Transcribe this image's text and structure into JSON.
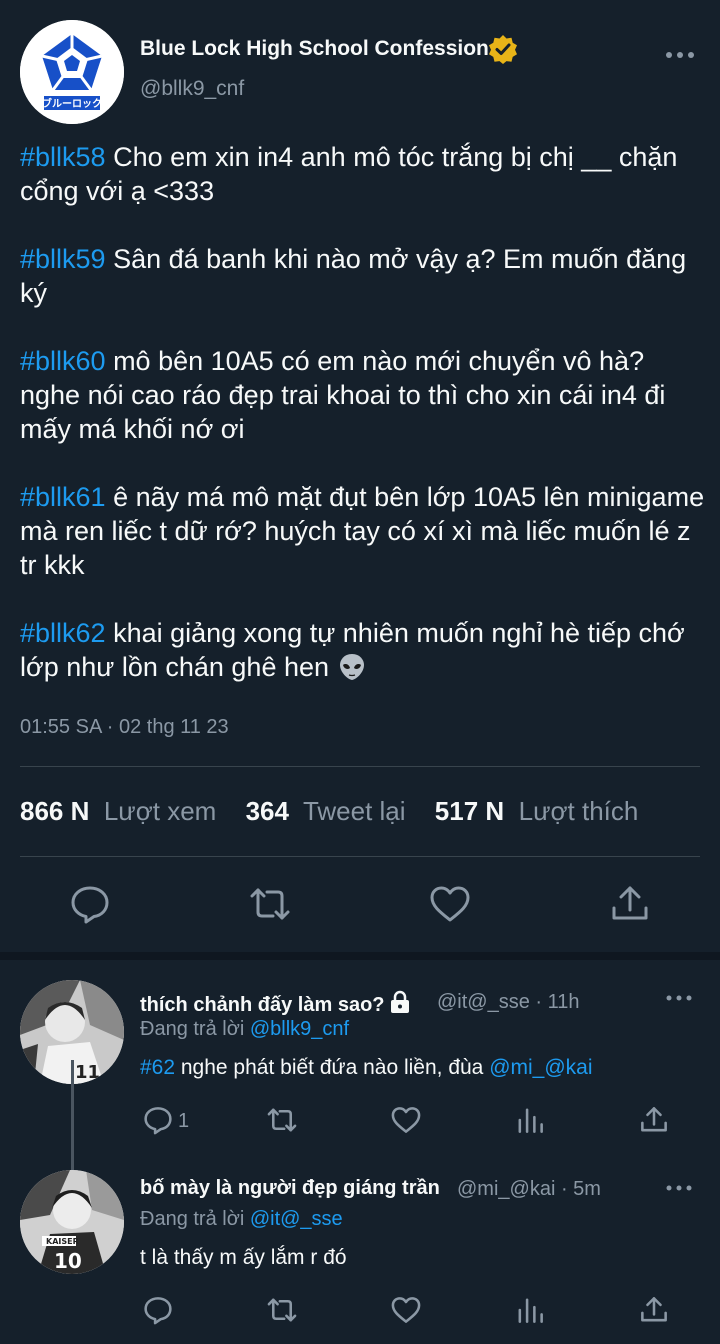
{
  "tweet": {
    "author": {
      "name": "Blue Lock High School Confession",
      "handle": "@bllk9_cnf",
      "logo_text": "ブルーロック"
    },
    "posts": [
      {
        "tag": "#bllk58",
        "text": " Cho em xin in4 anh mô tóc trắng bị chị __ chặn cổng với ạ <333"
      },
      {
        "tag": "#bllk59",
        "text": " Sân đá banh khi nào mở vậy ạ? Em muốn đăng ký"
      },
      {
        "tag": "#bllk60",
        "text": " mô bên 10A5 có em nào mới chuyển vô hà? nghe nói cao ráo đẹp trai khoai to thì cho xin cái in4 đi mấy má khối nớ ơi"
      },
      {
        "tag": "#bllk61",
        "text": " ê nãy má mô mặt đụt bên lớp 10A5 lên minigame mà ren liếc t dữ rớ? huých tay có xí xì mà liếc muốn lé z tr kkk"
      },
      {
        "tag": "#bllk62",
        "text": " khai giảng xong tự nhiên muốn nghỉ hè tiếp chớ lớp như lồn chán ghê hen "
      }
    ],
    "timestamp": "01:55 SA · 02 thg 11 23",
    "stats": {
      "views_value": "866 N",
      "views_label": "Lượt xem",
      "retweets_value": "364",
      "retweets_label": "Tweet lại",
      "likes_value": "517 N",
      "likes_label": "Lượt thích"
    }
  },
  "replies": [
    {
      "name": "thích chảnh đấy làm sao?",
      "handle": "@it@_sse · 11h",
      "replying_label": "Đang trả lời ",
      "replying_to": "@bllk9_cnf",
      "text_tag": "#62",
      "text": " nghe phát biết đứa nào liền, đùa ",
      "text_mention": "@mi_@kai",
      "reply_count": "1"
    },
    {
      "name": "bố mày là người đẹp giáng trần",
      "handle": "@mi_@kai · 5m",
      "replying_label": "Đang trả lời ",
      "replying_to": "@it@_sse",
      "text": "t là thấy m ấy lắm r đó",
      "reply_count": ""
    }
  ],
  "colors": {
    "background": "#15202b",
    "accent": "#1d9bf0",
    "muted": "#8b98a5",
    "verified": "#e8b418"
  }
}
